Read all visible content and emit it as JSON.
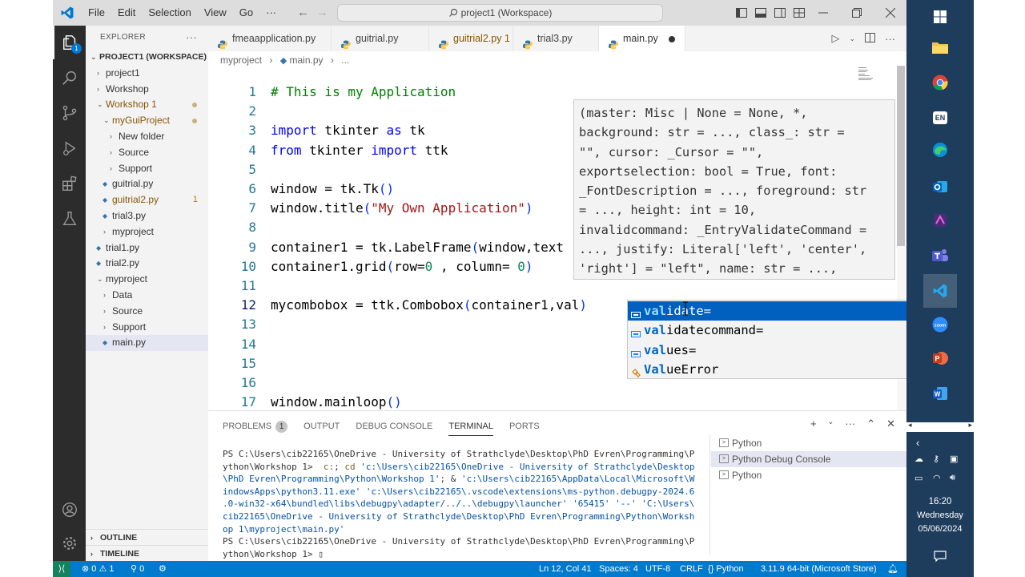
{
  "titlebar": {
    "menu": [
      "File",
      "Edit",
      "Selection",
      "View",
      "Go"
    ],
    "more": "···",
    "command_center": "project1 (Workspace)"
  },
  "activitybar": {
    "explorer_badge": "1"
  },
  "sidebar": {
    "header": "EXPLORER",
    "more": "···",
    "workspace": "PROJECT1 (WORKSPACE)",
    "tree": [
      {
        "label": "project1",
        "type": "folder",
        "open": false
      },
      {
        "label": "Workshop",
        "type": "folder",
        "open": false
      },
      {
        "label": "Workshop 1",
        "type": "folder",
        "open": true,
        "modified": true
      },
      {
        "label": "myGuiProject",
        "type": "folder",
        "open": true,
        "modified": true
      },
      {
        "label": "New folder",
        "type": "folder",
        "open": false
      },
      {
        "label": "Source",
        "type": "folder",
        "open": false
      },
      {
        "label": "Support",
        "type": "folder",
        "open": false
      },
      {
        "label": "guitrial.py",
        "type": "file"
      },
      {
        "label": "guitrial2.py",
        "type": "file",
        "modified": true,
        "count": "1"
      },
      {
        "label": "trial3.py",
        "type": "file"
      },
      {
        "label": "myproject",
        "type": "folder",
        "open": false
      },
      {
        "label": "trial1.py",
        "type": "file"
      },
      {
        "label": "trial2.py",
        "type": "file"
      },
      {
        "label": "myproject",
        "type": "folder",
        "open": true
      },
      {
        "label": "Data",
        "type": "folder",
        "open": false
      },
      {
        "label": "Source",
        "type": "folder",
        "open": false
      },
      {
        "label": "Support",
        "type": "folder",
        "open": false
      },
      {
        "label": "main.py",
        "type": "file",
        "selected": true
      }
    ],
    "outline": "OUTLINE",
    "timeline": "TIMELINE"
  },
  "tabs": [
    {
      "label": "fmeaapplication.py"
    },
    {
      "label": "guitrial.py"
    },
    {
      "label": "guitrial2.py 1",
      "modified": true
    },
    {
      "label": "trial3.py"
    },
    {
      "label": "main.py",
      "active": true,
      "dirty": true
    }
  ],
  "breadcrumb": [
    "myproject",
    "main.py",
    "..."
  ],
  "code_lines": [
    {
      "n": "1",
      "html": "<span class=\"cm\"># This is my Application</span>"
    },
    {
      "n": "2",
      "html": ""
    },
    {
      "n": "3",
      "html": "<span class=\"kw\">import</span> tkinter <span class=\"kw\">as</span> tk"
    },
    {
      "n": "4",
      "html": "<span class=\"kw\">from</span> tkinter <span class=\"kw\">import</span> ttk"
    },
    {
      "n": "5",
      "html": ""
    },
    {
      "n": "6",
      "html": "window = tk.Tk<span class=\"paren\">()</span>"
    },
    {
      "n": "7",
      "html": "window.title<span class=\"paren\">(</span><span class=\"str\">\"My Own Application\"</span><span class=\"paren\">)</span>"
    },
    {
      "n": "8",
      "html": ""
    },
    {
      "n": "9",
      "html": "container1 = tk.LabelFrame<span class=\"paren\">(</span>window,text"
    },
    {
      "n": "10",
      "html": "container1.grid<span class=\"paren\">(</span>row=<span class=\"num\">0</span> , column= <span class=\"num\">0</span><span class=\"paren\">)</span>"
    },
    {
      "n": "11",
      "html": ""
    },
    {
      "n": "12",
      "html": "mycombobox = ttk.Combobox<span class=\"paren\">(</span>container1,val<span class=\"paren\">)</span>"
    },
    {
      "n": "13",
      "html": ""
    },
    {
      "n": "14",
      "html": ""
    },
    {
      "n": "15",
      "html": ""
    },
    {
      "n": "16",
      "html": ""
    },
    {
      "n": "17",
      "html": "window.mainloop<span class=\"paren\">()</span>"
    }
  ],
  "hover_signature": "(master: Misc | None = None, *,\nbackground: str = ..., class_: str =\n\"\", cursor: _Cursor = \"\",\nexportselection: bool = True, font:\n_FontDescription = ..., foreground: str\n= ..., height: int = 10,\ninvalidcommand: _EntryValidateCommand =\n..., justify: Literal['left', 'center',\n'right'] = \"left\", name: str = ...,",
  "suggestions": [
    {
      "match": "val",
      "rest": "idate=",
      "kind": "variable",
      "selected": true
    },
    {
      "match": "val",
      "rest": "idatecommand=",
      "kind": "variable"
    },
    {
      "match": "val",
      "rest": "ues=",
      "kind": "variable"
    },
    {
      "match": "Val",
      "rest": "ueError",
      "kind": "class"
    }
  ],
  "panel": {
    "tabs": [
      "PROBLEMS",
      "OUTPUT",
      "DEBUG CONSOLE",
      "TERMINAL",
      "PORTS"
    ],
    "problems_count": "1",
    "active_tab": "TERMINAL",
    "terminal_html": "PS C:\\Users\\cib22165\\OneDrive - University of Strathclyde\\Desktop\\PhD Evren\\Programming\\P\nython\\Workshop 1>  <span class=\"t-y\">c:</span>; <span class=\"t-y\">cd</span> <span class=\"t-cmd\">'c:\\Users\\cib22165\\OneDrive - University of Strathclyde\\Desktop</span>\n<span class=\"t-cmd\">\\PhD Evren\\Programming\\Python\\Workshop 1'</span>; & <span class=\"t-cmd\">'c:\\Users\\cib22165\\AppData\\Local\\Microsoft\\W</span>\n<span class=\"t-cmd\">indowsApps\\python3.11.exe'</span> <span class=\"t-cmd\">'c:\\Users\\cib22165\\.vscode\\extensions\\ms-python.debugpy-2024.6</span>\n<span class=\"t-cmd\">.0-win32-x64\\bundled\\libs\\debugpy\\adapter/../..\\debugpy\\launcher'</span> <span class=\"t-cmd\">'65415'</span> <span class=\"t-cmd\">'--'</span> <span class=\"t-cmd\">'C:\\Users\\</span>\n<span class=\"t-cmd\">cib22165\\OneDrive - University of Strathclyde\\Desktop\\PhD Evren\\Programming\\Python\\Worksh</span>\n<span class=\"t-cmd\">op 1\\myproject\\main.py'</span>\nPS C:\\Users\\cib22165\\OneDrive - University of Strathclyde\\Desktop\\PhD Evren\\Programming\\P\nython\\Workshop 1> ▯",
    "terminals": [
      {
        "label": "Python"
      },
      {
        "label": "Python Debug Console",
        "selected": true
      },
      {
        "label": "Python"
      }
    ]
  },
  "statusbar": {
    "errors": "0",
    "warnings": "1",
    "ports": "0",
    "position": "Ln 12, Col 41",
    "spaces": "Spaces: 4",
    "encoding": "UTF-8",
    "eol": "CRLF",
    "language": "Python",
    "interpreter": "3.11.9 64-bit (Microsoft Store)"
  },
  "taskbar": {
    "lang": "EN",
    "time": "16:20",
    "day": "Wednesday",
    "date": "05/06/2024"
  },
  "colors": {
    "accent": "#007acc",
    "activitybar": "#2c2c2c",
    "taskbar": "#1e3c5c",
    "suggest_selected": "#0060c0"
  }
}
